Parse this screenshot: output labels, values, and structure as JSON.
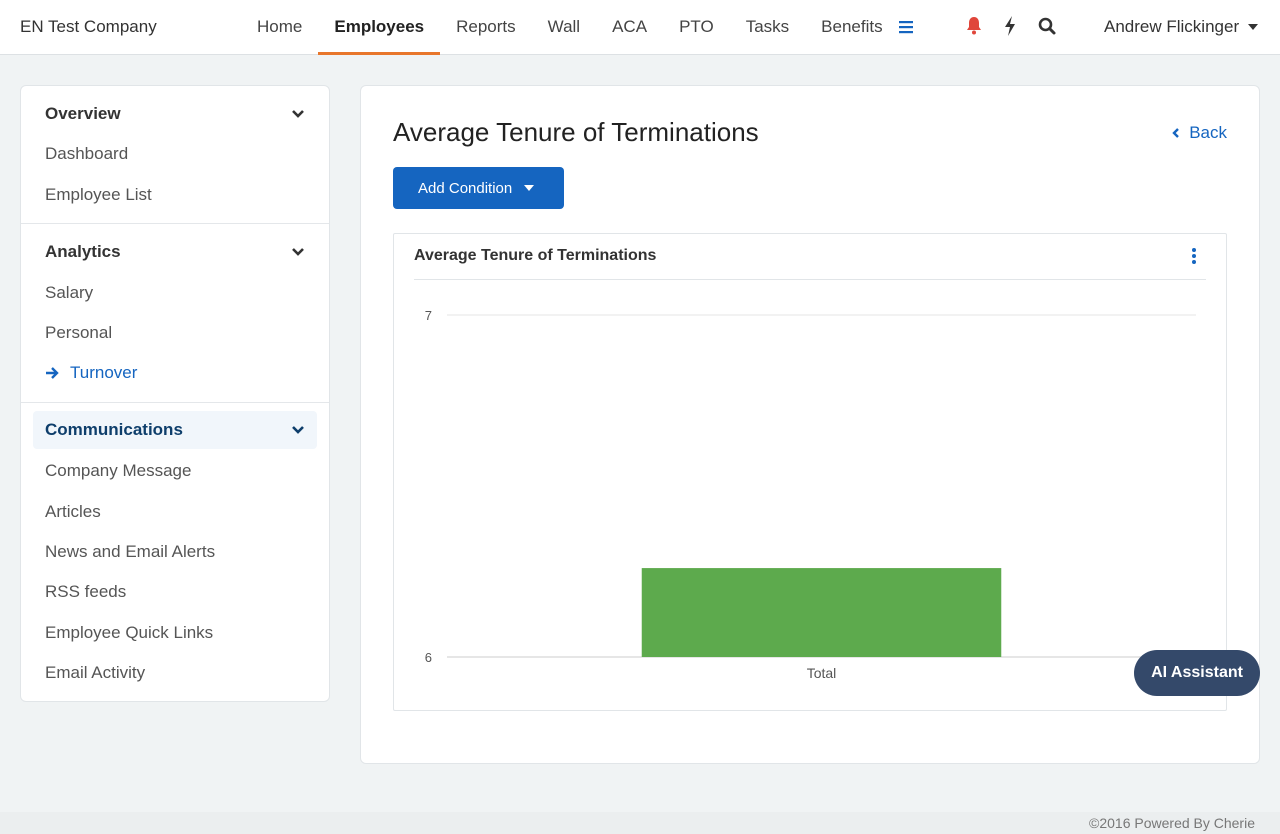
{
  "app": {
    "company": "EN Test Company"
  },
  "nav": {
    "items": [
      {
        "label": "Home"
      },
      {
        "label": "Employees",
        "active": true
      },
      {
        "label": "Reports"
      },
      {
        "label": "Wall"
      },
      {
        "label": "ACA"
      },
      {
        "label": "PTO"
      },
      {
        "label": "Tasks"
      },
      {
        "label": "Benefits"
      }
    ],
    "icons": [
      "menu-icon",
      "bell-icon",
      "bolt-icon",
      "search-icon"
    ],
    "user": "Andrew Flickinger"
  },
  "sidebar": {
    "overview": {
      "title": "Overview",
      "items": [
        "Dashboard",
        "Employee List"
      ]
    },
    "analytics": {
      "title": "Analytics",
      "items": [
        "Salary",
        "Personal",
        "Turnover"
      ],
      "current": "Turnover"
    },
    "communications": {
      "title": "Communications",
      "items": [
        "Company Message",
        "Articles",
        "News and Email Alerts",
        "RSS feeds",
        "Employee Quick Links",
        "Email Activity"
      ]
    }
  },
  "main": {
    "title": "Average Tenure of Terminations",
    "back_label": "Back",
    "add_condition_label": "Add Condition"
  },
  "chart_card": {
    "title": "Average Tenure of Terminations"
  },
  "chart_data": {
    "type": "bar",
    "categories": [
      "Total"
    ],
    "values": [
      6.26
    ],
    "ylim": [
      6,
      7
    ],
    "yticks": [
      "6",
      "7"
    ],
    "grid": true,
    "bar_color": "#5daa4d"
  },
  "ai_assistant_label": "AI Assistant",
  "footer": "©2016 Powered By Cherie",
  "colors": {
    "accent": "#1565c0",
    "nav_underline": "#e8762b",
    "bell": "#e0463b"
  }
}
